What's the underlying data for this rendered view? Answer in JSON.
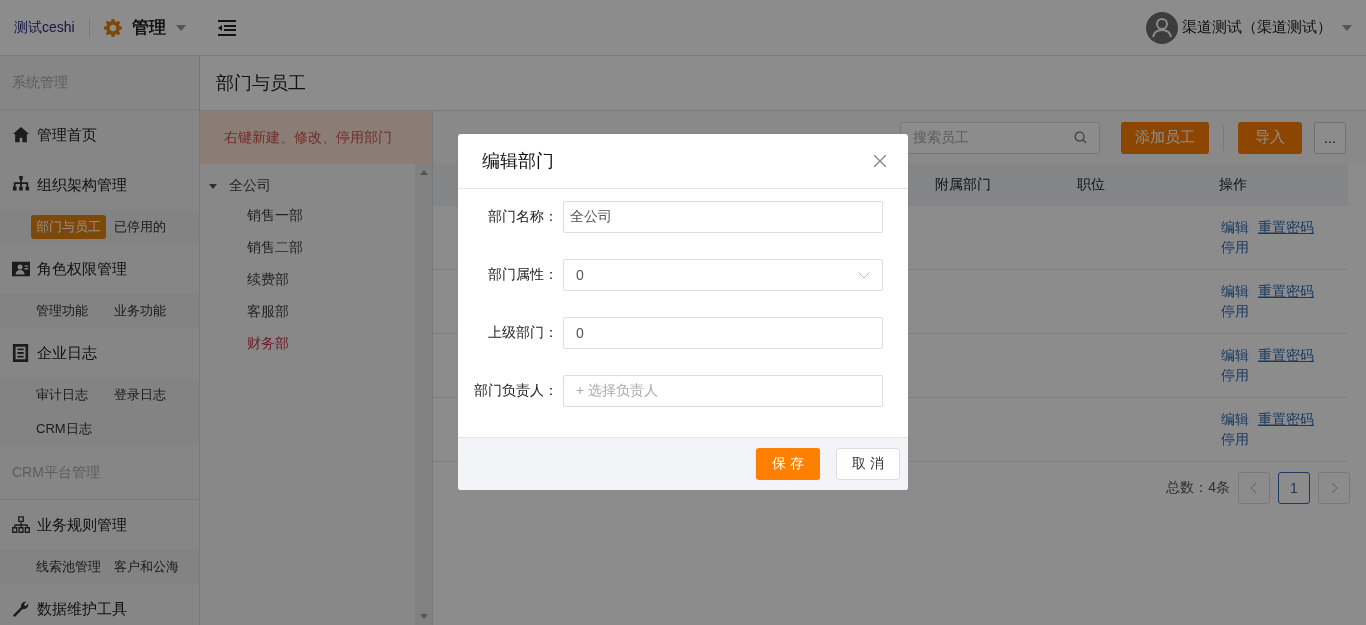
{
  "top_bar": {
    "brand": "测试ceshi",
    "module": "管理",
    "user": "渠道测试（渠道测试）"
  },
  "sidebar": [
    {
      "kind": "section",
      "label": "系统管理"
    },
    {
      "kind": "menu",
      "label": "管理首页"
    },
    {
      "kind": "menu",
      "label": "组织架构管理",
      "children": [
        {
          "label": "部门与员工",
          "selected": true
        },
        {
          "label": "已停用的",
          "selected": false
        }
      ]
    },
    {
      "kind": "menu",
      "label": "角色权限管理",
      "children": [
        {
          "label": "管理功能",
          "selected": false
        },
        {
          "label": "业务功能",
          "selected": false
        }
      ]
    },
    {
      "kind": "menu",
      "label": "企业日志",
      "children": [
        {
          "label": "审计日志",
          "selected": false
        },
        {
          "label": "登录日志",
          "selected": false
        },
        {
          "label": "CRM日志",
          "selected": false
        }
      ]
    },
    {
      "kind": "section",
      "label": "CRM平台管理"
    },
    {
      "kind": "menu",
      "label": "业务规则管理",
      "children": [
        {
          "label": "线索池管理",
          "selected": false
        },
        {
          "label": "客户和公海",
          "selected": false
        }
      ]
    },
    {
      "kind": "menu",
      "label": "数据维护工具"
    }
  ],
  "page_title": "部门与员工",
  "dept_panel": {
    "notice": "右键新建、修改、停用部门",
    "tree": [
      {
        "label": "全公司",
        "expanded": true,
        "selected": false,
        "children": [
          {
            "label": "销售一部",
            "selected": false
          },
          {
            "label": "销售二部",
            "selected": false
          },
          {
            "label": "续费部",
            "selected": false
          },
          {
            "label": "客服部",
            "selected": false
          },
          {
            "label": "财务部",
            "selected": true
          }
        ]
      }
    ]
  },
  "toolbar": {
    "search_placeholder": "搜索员工",
    "buttons": [
      {
        "kind": "primary",
        "label": "添加员工"
      },
      {
        "kind": "primary",
        "label": "导入"
      },
      {
        "kind": "more",
        "label": "..."
      }
    ]
  },
  "table": {
    "columns": [
      "附属部门",
      "职位",
      "操作"
    ],
    "rows": [
      {
        "actions": [
          "编辑",
          "重置密码",
          "停用"
        ]
      },
      {
        "actions": [
          "编辑",
          "重置密码",
          "停用"
        ]
      },
      {
        "actions": [
          "编辑",
          "重置密码",
          "停用"
        ]
      },
      {
        "actions": [
          "编辑",
          "重置密码",
          "停用"
        ]
      }
    ]
  },
  "pagination": {
    "total": "总数：4条",
    "pages": [
      {
        "label": "1",
        "selected": true
      }
    ]
  },
  "dialog": {
    "title": "编辑部门",
    "fields": [
      {
        "kind": "text",
        "label": "部门名称：",
        "value": "全公司"
      },
      {
        "kind": "select",
        "label": "部门属性：",
        "value": "0"
      },
      {
        "kind": "text",
        "label": "上级部门：",
        "value": "0"
      },
      {
        "kind": "picker",
        "label": "部门负责人：",
        "placeholder": "+ 选择负责人"
      }
    ],
    "buttons": [
      {
        "kind": "primary",
        "label": "保 存"
      },
      {
        "kind": "default",
        "label": "取 消"
      }
    ]
  }
}
